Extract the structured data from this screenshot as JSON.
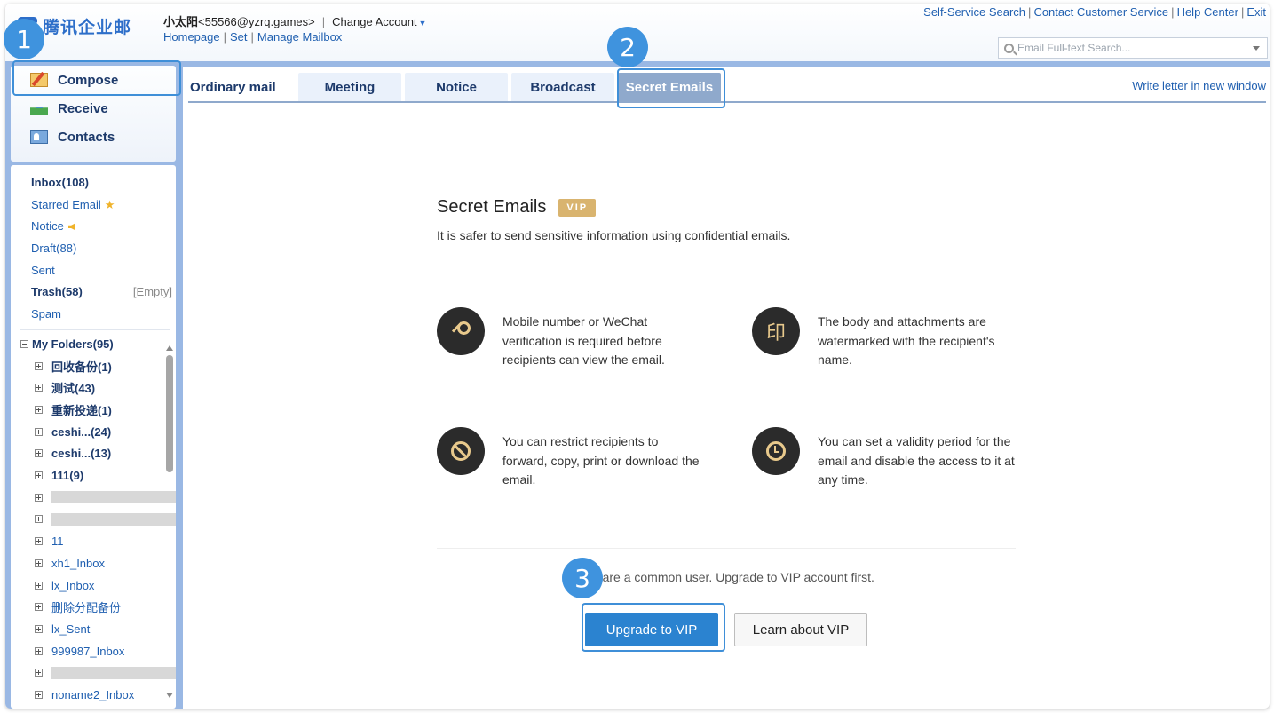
{
  "header": {
    "logo_text": "腾讯企业邮",
    "account_name": "小太阳",
    "account_email": "<55566@yzrq.games>",
    "change_account": "Change Account",
    "links": [
      "Homepage",
      "Set",
      "Manage Mailbox"
    ],
    "top_links": [
      "Self-Service Search",
      "Contact Customer Service",
      "Help Center",
      "Exit"
    ],
    "search_placeholder": "Email Full-text Search..."
  },
  "nav": {
    "compose": "Compose",
    "receive": "Receive",
    "contacts": "Contacts"
  },
  "folders": {
    "inbox": "Inbox(108)",
    "starred": "Starred Email",
    "notice": "Notice",
    "draft": "Draft(88)",
    "sent": "Sent",
    "trash": "Trash(58)",
    "trash_action": "[Empty]",
    "spam": "Spam",
    "my_folders": "My Folders(95)",
    "sub": [
      "回收备份(1)",
      "测试(43)",
      "重新投递(1)",
      "ceshi...(24)",
      "ceshi...(13)",
      "111(9)",
      "",
      "",
      "11",
      "xh1_Inbox",
      "lx_Inbox",
      "删除分配备份",
      "lx_Sent",
      "999987_Inbox",
      "",
      "noname2_Inbox"
    ]
  },
  "tabs": [
    "Ordinary mail",
    "Meeting",
    "Notice",
    "Broadcast",
    "Secret Emails"
  ],
  "write_new_window": "Write letter in new window",
  "content": {
    "title": "Secret Emails",
    "vip_badge": "VIP",
    "subtitle": "It is safer to send sensitive information using confidential emails.",
    "features": [
      {
        "icon": "key-icon",
        "text": "Mobile number or WeChat verification is required before recipients can view the email."
      },
      {
        "icon": "seal-icon",
        "glyph": "印",
        "text": "The body and attachments are watermarked with the recipient's name."
      },
      {
        "icon": "ban-icon",
        "text": "You can restrict recipients to forward, copy, print or download the email."
      },
      {
        "icon": "clock-icon",
        "text": "You can set a validity period for the email and disable the access to it at any time."
      }
    ],
    "notice": "You are a common user. Upgrade to VIP account first.",
    "upgrade_button": "Upgrade to VIP",
    "learn_button": "Learn about VIP"
  },
  "annotations": [
    "1",
    "2",
    "3"
  ],
  "colors": {
    "accent": "#2b83d0",
    "annotation": "#3f93de",
    "vip": "#d9b46f",
    "active_tab": "#8fa9cc"
  }
}
